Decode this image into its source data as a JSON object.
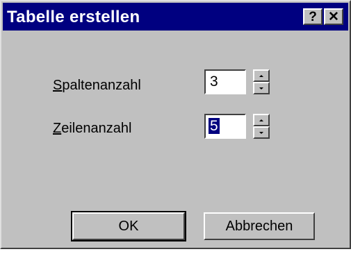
{
  "window": {
    "title": "Tabelle erstellen",
    "help_glyph": "?",
    "close_glyph": "✕"
  },
  "form": {
    "columns": {
      "label_mnemonic": "S",
      "label_rest": "paltenanzahl",
      "value": "3"
    },
    "rows": {
      "label_mnemonic": "Z",
      "label_rest": "eilenanzahl",
      "value": "5"
    }
  },
  "buttons": {
    "ok_label": "OK",
    "cancel_label": "Abbrechen"
  },
  "colors": {
    "titlebar": "#000080",
    "dialog_face": "#c0c0c0",
    "selection": "#000080"
  }
}
